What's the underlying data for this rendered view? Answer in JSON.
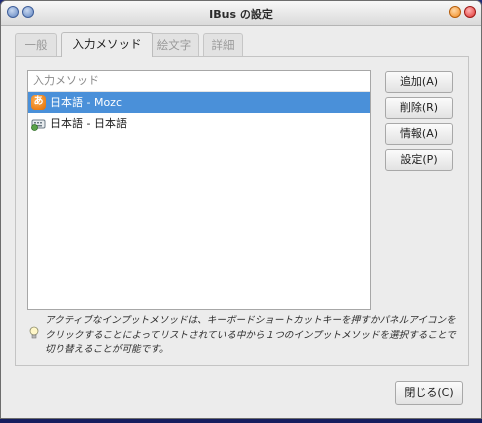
{
  "window": {
    "title": "IBus の設定"
  },
  "tabs": [
    {
      "label": "一般",
      "active": false
    },
    {
      "label": "入力メソッド",
      "active": true
    },
    {
      "label": "絵文字",
      "active": false
    },
    {
      "label": "詳細",
      "active": false
    }
  ],
  "input_methods": {
    "header": "入力メソッド",
    "items": [
      {
        "label": "日本語 - Mozc",
        "icon": "mozc-icon",
        "icon_glyph": "あ",
        "selected": true
      },
      {
        "label": "日本語 - 日本語",
        "icon": "keyboard-icon",
        "selected": false
      }
    ]
  },
  "buttons": {
    "add": "追加(A)",
    "remove": "削除(R)",
    "info": "情報(A)",
    "settings": "設定(P)",
    "close": "閉じる(C)"
  },
  "hint": {
    "icon": "lightbulb-icon",
    "text": "アクティブなインプットメソッドは、キーボードショートカットキーを押すかパネルアイコンをクリックすることによってリストされている中から１つのインプットメソッドを選択することで切り替えることが可能です。"
  },
  "colors": {
    "selection": "#4a90d9",
    "desktop": "#1e2a78"
  }
}
